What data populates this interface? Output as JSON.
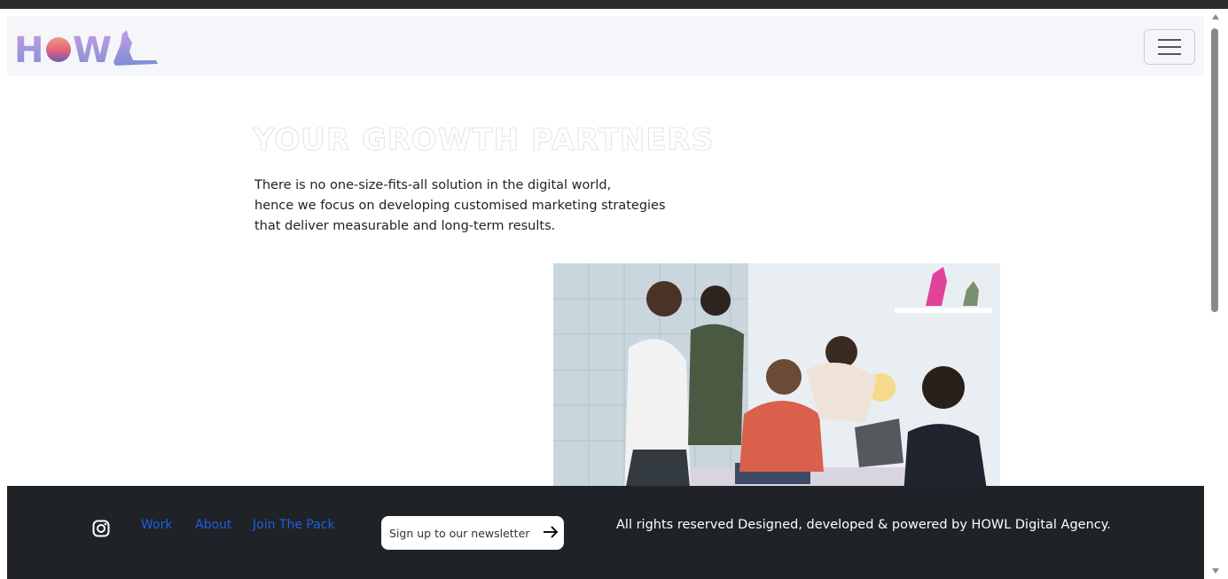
{
  "header": {
    "logo_text": "HOWL",
    "menu_icon": "hamburger-menu-icon"
  },
  "hero": {
    "title": "YOUR GROWTH PARTNERS",
    "text_line1": "There is no one-size-fits-all solution in the digital world,",
    "text_line2": "hence we focus on developing customised marketing strategies",
    "text_line3": "that deliver measurable and long-term results."
  },
  "footer": {
    "social_icon": "instagram-icon",
    "links": [
      "Work",
      "About",
      "Join The Pack"
    ],
    "newsletter_placeholder": "Sign up to our newsletter",
    "submit_icon": "arrow-right-icon",
    "copyright": "All rights reserved Designed, developed & powered by HOWL Digital Agency."
  },
  "colors": {
    "footer_bg": "#1f2227",
    "link": "#1f5fe0",
    "navbar_bg": "#f4f6f9"
  }
}
